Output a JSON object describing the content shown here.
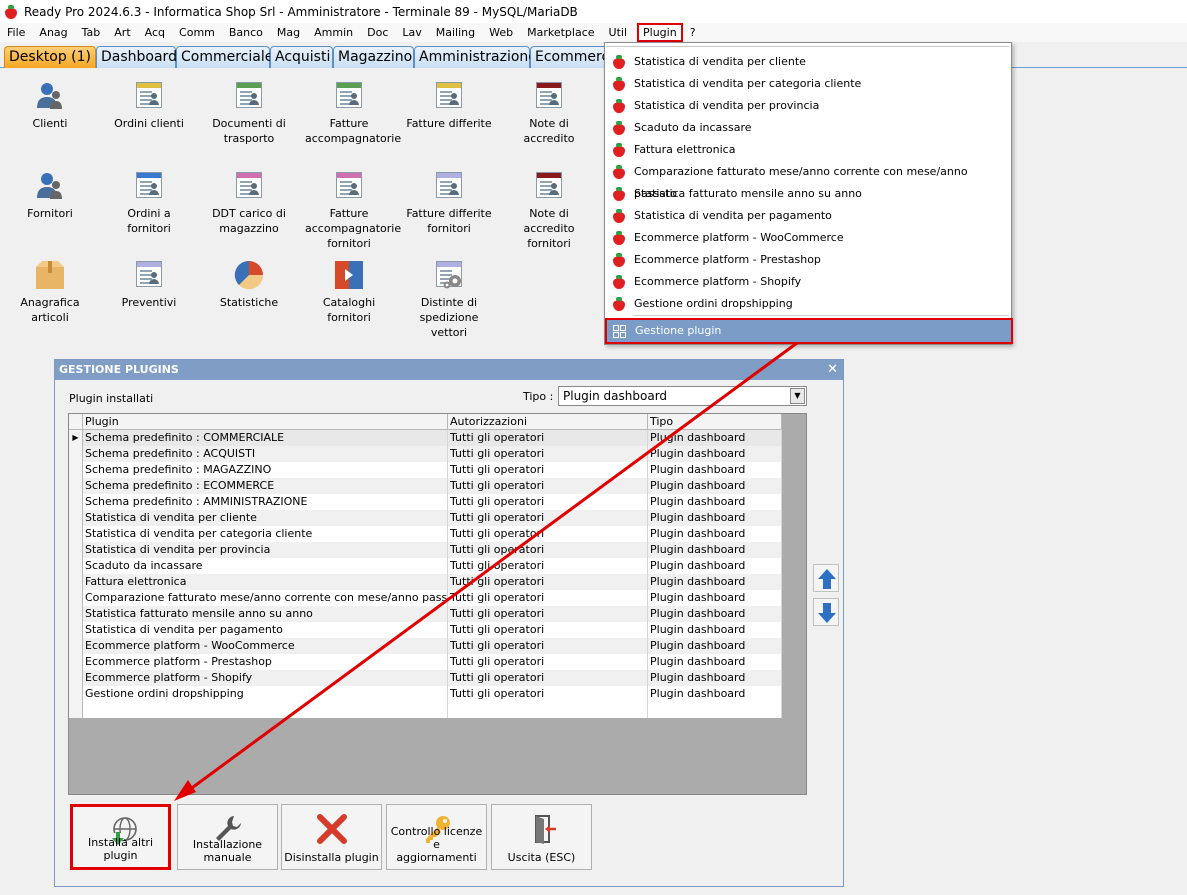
{
  "window": {
    "title": "Ready Pro 2024.6.3 - Informatica Shop Srl - Amministratore - Terminale 89 - MySQL/MariaDB"
  },
  "menubar": {
    "items": [
      "File",
      "Anag",
      "Tab",
      "Art",
      "Acq",
      "Comm",
      "Banco",
      "Mag",
      "Ammin",
      "Doc",
      "Lav",
      "Mailing",
      "Web",
      "Marketplace",
      "Util",
      "Plugin",
      "?"
    ]
  },
  "tabs": [
    "Desktop (1)",
    "Dashboard",
    "Commerciale",
    "Acquisti",
    "Magazzino",
    "Amministrazione",
    "Ecommerce"
  ],
  "desktop_icons": [
    {
      "label": "Clienti",
      "icon": "customer-icon"
    },
    {
      "label": "Ordini clienti",
      "icon": "orders-icon",
      "color": "#e0c040"
    },
    {
      "label": "Documenti di trasporto",
      "icon": "transport-doc-icon",
      "color": "#5aa050"
    },
    {
      "label": "Fatture accompagnatorie",
      "icon": "invoice-icon",
      "color": "#5aa050"
    },
    {
      "label": "Fatture differite",
      "icon": "deferred-invoice-icon",
      "color": "#e0c040"
    },
    {
      "label": "Note di accredito",
      "icon": "credit-note-icon",
      "color": "#8b1a1a"
    },
    {
      "label": "Fornitori",
      "icon": "supplier-icon"
    },
    {
      "label": "Ordini a fornitori",
      "icon": "supplier-orders-icon",
      "color": "#3a78d0"
    },
    {
      "label": "DDT carico di magazzino",
      "icon": "ddt-icon",
      "color": "#d070b0"
    },
    {
      "label": "Fatture accompagnatorie fornitori",
      "icon": "supplier-invoice-icon",
      "color": "#d070b0"
    },
    {
      "label": "Fatture differite fornitori",
      "icon": "supplier-deferred-icon",
      "color": "#b0b0e0"
    },
    {
      "label": "Note di accredito fornitori",
      "icon": "supplier-credit-icon",
      "color": "#8b1a1a"
    },
    {
      "label": "Anagrafica articoli",
      "icon": "box-icon"
    },
    {
      "label": "Preventivi",
      "icon": "quote-icon",
      "color": "#b0b0e0"
    },
    {
      "label": "Statistiche",
      "icon": "pie-chart-icon"
    },
    {
      "label": "Cataloghi fornitori",
      "icon": "catalog-icon"
    },
    {
      "label": "Distinte di spedizione vettori",
      "icon": "shipping-icon"
    }
  ],
  "plugin_menu": {
    "items": [
      "Statistica di vendita per cliente",
      "Statistica di vendita per categoria cliente",
      "Statistica di vendita per provincia",
      "Scaduto da incassare",
      "Fattura elettronica",
      "Comparazione fatturato mese/anno corrente con mese/anno passato",
      "Statistica fatturato mensile anno su anno",
      "Statistica di vendita per pagamento",
      "Ecommerce platform - WooCommerce",
      "Ecommerce platform - Prestashop",
      "Ecommerce platform - Shopify",
      "Gestione ordini dropshipping"
    ],
    "selected": "Gestione plugin"
  },
  "dialog": {
    "title": "GESTIONE PLUGINS",
    "installed_label": "Plugin installati",
    "type_label": "Tipo :",
    "type_value": "Plugin dashboard",
    "columns": [
      "Plugin",
      "Autorizzazioni",
      "Tipo"
    ],
    "rows": [
      [
        "Schema predefinito : COMMERCIALE",
        "Tutti gli operatori",
        "Plugin dashboard"
      ],
      [
        "Schema predefinito : ACQUISTI",
        "Tutti gli operatori",
        "Plugin dashboard"
      ],
      [
        "Schema predefinito : MAGAZZINO",
        "Tutti gli operatori",
        "Plugin dashboard"
      ],
      [
        "Schema predefinito : ECOMMERCE",
        "Tutti gli operatori",
        "Plugin dashboard"
      ],
      [
        "Schema predefinito : AMMINISTRAZIONE",
        "Tutti gli operatori",
        "Plugin dashboard"
      ],
      [
        "Statistica di vendita per cliente",
        "Tutti gli operatori",
        "Plugin dashboard"
      ],
      [
        "Statistica di vendita per categoria cliente",
        "Tutti gli operatori",
        "Plugin dashboard"
      ],
      [
        "Statistica di vendita per provincia",
        "Tutti gli operatori",
        "Plugin dashboard"
      ],
      [
        "Scaduto da incassare",
        "Tutti gli operatori",
        "Plugin dashboard"
      ],
      [
        "Fattura elettronica",
        "Tutti gli operatori",
        "Plugin dashboard"
      ],
      [
        "Comparazione fatturato mese/anno corrente con mese/anno passato",
        "Tutti gli operatori",
        "Plugin dashboard"
      ],
      [
        "Statistica fatturato mensile anno su anno",
        "Tutti gli operatori",
        "Plugin dashboard"
      ],
      [
        "Statistica di vendita per pagamento",
        "Tutti gli operatori",
        "Plugin dashboard"
      ],
      [
        "Ecommerce platform - WooCommerce",
        "Tutti gli operatori",
        "Plugin dashboard"
      ],
      [
        "Ecommerce platform - Prestashop",
        "Tutti gli operatori",
        "Plugin dashboard"
      ],
      [
        "Ecommerce platform - Shopify",
        "Tutti gli operatori",
        "Plugin dashboard"
      ],
      [
        "Gestione ordini dropshipping",
        "Tutti gli operatori",
        "Plugin dashboard"
      ]
    ],
    "buttons": [
      {
        "label": "Installa altri plugin",
        "icon": "globe-download-icon"
      },
      {
        "label": "Installazione manuale",
        "icon": "wrench-icon"
      },
      {
        "label": "Disinstalla plugin",
        "icon": "red-x-icon"
      },
      {
        "label": "Controllo licenze e aggiornamenti",
        "icon": "key-icon"
      },
      {
        "label": "Uscita (ESC)",
        "icon": "exit-door-icon"
      }
    ]
  },
  "colors": {
    "highlight": "#e00000",
    "dialog_title_bg": "#7f9dc5",
    "tab_active": "#f5a623",
    "menu_selected": "#7a9cc6"
  }
}
